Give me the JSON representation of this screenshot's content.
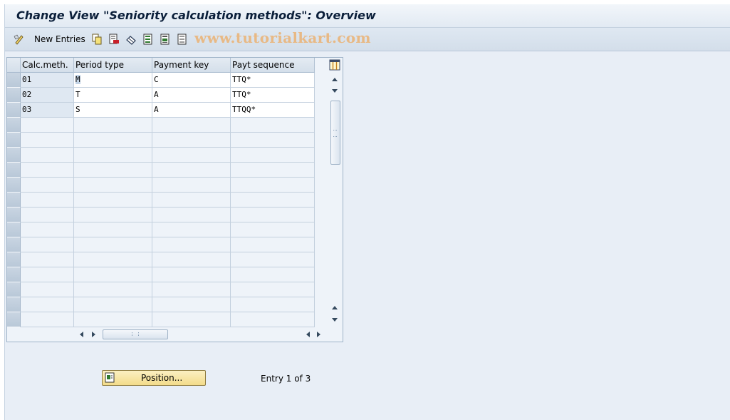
{
  "window": {
    "title": "Change View \"Seniority calculation methods\": Overview"
  },
  "toolbar": {
    "new_entries_label": "New Entries",
    "watermark": "www.tutorialkart.com",
    "icons": [
      "display-change-icon",
      "copy-icon",
      "delete-icon",
      "undo-icon",
      "select-all-icon",
      "select-block-icon",
      "deselect-all-icon"
    ]
  },
  "table": {
    "columns": [
      "Calc.meth.",
      "Period type",
      "Payment key",
      "Payt sequence"
    ],
    "rows": [
      [
        "01",
        "M",
        "C",
        "TTQ*"
      ],
      [
        "02",
        "T",
        "A",
        "TTQ*"
      ],
      [
        "03",
        "S",
        "A",
        "TTQQ*"
      ]
    ],
    "empty_rows": 14
  },
  "footer": {
    "position_button_label": "Position...",
    "entry_info": "Entry 1 of 3"
  }
}
